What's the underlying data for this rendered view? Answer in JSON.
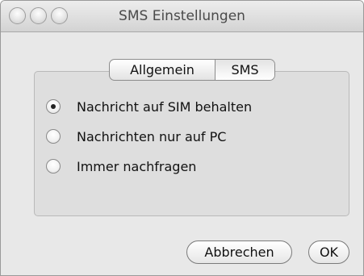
{
  "window": {
    "title": "SMS Einstellungen"
  },
  "tabs": [
    {
      "label": "Allgemein",
      "selected": false
    },
    {
      "label": "SMS",
      "selected": true
    }
  ],
  "radio_options": [
    {
      "label": "Nachricht auf SIM behalten",
      "checked": true
    },
    {
      "label": "Nachrichten nur auf PC",
      "checked": false
    },
    {
      "label": "Immer nachfragen",
      "checked": false
    }
  ],
  "buttons": {
    "cancel_label": "Abbrechen",
    "ok_label": "OK"
  }
}
